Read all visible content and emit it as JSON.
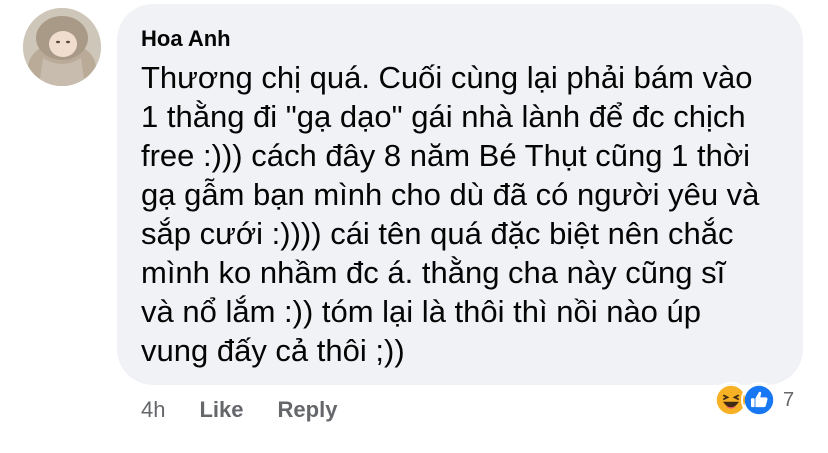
{
  "comment": {
    "author": "Hoa Anh",
    "lines": [
      "Thương chị quá. Cuối cùng lại phải bám vào",
      "1 thằng đi \"gạ dạo\" gái nhà lành để đc chịch",
      "free :))) cách đây 8 năm Bé Thụt cũng 1 thời",
      "gạ gẫm bạn mình cho dù đã có người yêu và",
      "sắp cưới :)))) cái tên quá đặc biệt nên chắc",
      "mình ko nhầm đc á. thằng cha này cũng sĩ",
      "và nổ lắm :)) tóm lại là thôi thì nồi nào úp",
      "vung đấy cả thôi ;))"
    ]
  },
  "actions": {
    "time": "4h",
    "like_label": "Like",
    "reply_label": "Reply"
  },
  "reactions": {
    "icons": [
      "haha-icon",
      "like-icon"
    ],
    "count": "7"
  },
  "colors": {
    "bubble": "#f0f2f5",
    "text": "#050505",
    "meta": "#65676b",
    "like_blue": "#1877f2",
    "haha_yellow": "#f7b125"
  }
}
